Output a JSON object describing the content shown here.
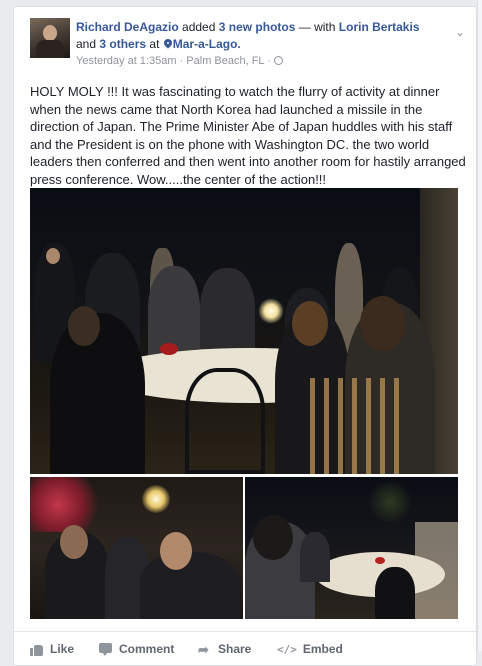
{
  "post": {
    "author": "Richard DeAgazio",
    "action_text": "added",
    "photo_count_label": "3 new photos",
    "with_text": "— with",
    "tagged_person": "Lorin Bertakis",
    "and_text": "and",
    "others_label": "3 others",
    "at_text": "at",
    "location": "Mar-a-Lago.",
    "timestamp": "Yesterday at 1:35am",
    "place": "Palm Beach, FL",
    "separator": "·",
    "body": "HOLY MOLY !!! It was fascinating to watch the flurry of activity at dinner when the news came that North Korea had launched a missile in the direction of Japan. The Prime Minister Abe of Japan huddles with his staff and the President is on the phone with Washington DC. the two world leaders then conferred and then went into another room for hastily arranged press conference. Wow.....the center of the action!!!"
  },
  "icons": {
    "options": "chevron-down-icon",
    "location": "map-pin-icon",
    "privacy": "globe-icon",
    "like": "thumbs-up-icon",
    "comment": "speech-bubble-icon",
    "share": "share-arrow-icon",
    "embed": "code-brackets-icon"
  },
  "actions": {
    "like": "Like",
    "comment": "Comment",
    "share": "Share",
    "embed": "Embed",
    "share_glyph": "➦",
    "embed_glyph": "</>"
  },
  "chevron_glyph": "⌄",
  "colors": {
    "link": "#365899",
    "text": "#1d2129",
    "meta": "#90949c",
    "action": "#616770",
    "background": "#e9ebee"
  }
}
